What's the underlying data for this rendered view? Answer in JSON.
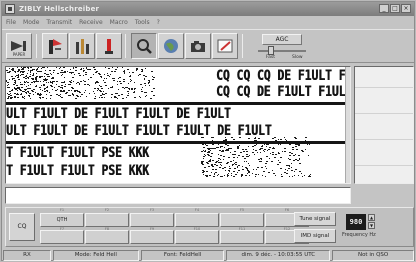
{
  "window": {
    "title": "ZIBLY Hellschreiber",
    "buttons": [
      "_",
      "□",
      "×"
    ]
  },
  "menu": [
    "File",
    "Mode",
    "Transmit",
    "Receive",
    "Macro",
    "Tools",
    "?"
  ],
  "toolbar": {
    "paper_label": "PAPER",
    "agc_label": "AGC",
    "slider_fast": "Fast",
    "slider_slow": "Slow"
  },
  "receive": {
    "lines": [
      "CQ CQ CQ DE F1ULT F1UL",
      "CQ CQ DE F1ULT F1UL",
      "ULT F1ULT DE F1ULT F1ULT DE F1ULT",
      "ULT F1ULT DE F1ULT F1ULT F1ULT DE F1ULT",
      "T F1ULT F1ULT PSE KKK",
      "T F1ULT F1ULT PSE KKK"
    ]
  },
  "macros": {
    "cq": "CQ",
    "fkeys_top": [
      "F1",
      "F2",
      "F3",
      "F4",
      "F5",
      "F6"
    ],
    "fkeys_bottom": [
      "F7",
      "F8",
      "F9",
      "F10",
      "F11",
      "F12"
    ],
    "top_labels": [
      "QTH",
      "",
      "",
      "",
      "",
      ""
    ],
    "bottom_labels": [
      "",
      "",
      "",
      "",
      "",
      ""
    ]
  },
  "signal": {
    "tune": "Tune signal",
    "imd": "IMD signal"
  },
  "frequency": {
    "value": "980",
    "label": "Frequency Hz"
  },
  "status": {
    "rx": "RX",
    "mode": "Mode: Feld Hell",
    "font": "Font: FeldHell",
    "datetime": "dim. 9 déc. - 10:03:55 UTC",
    "qso": "Not in QSO"
  }
}
